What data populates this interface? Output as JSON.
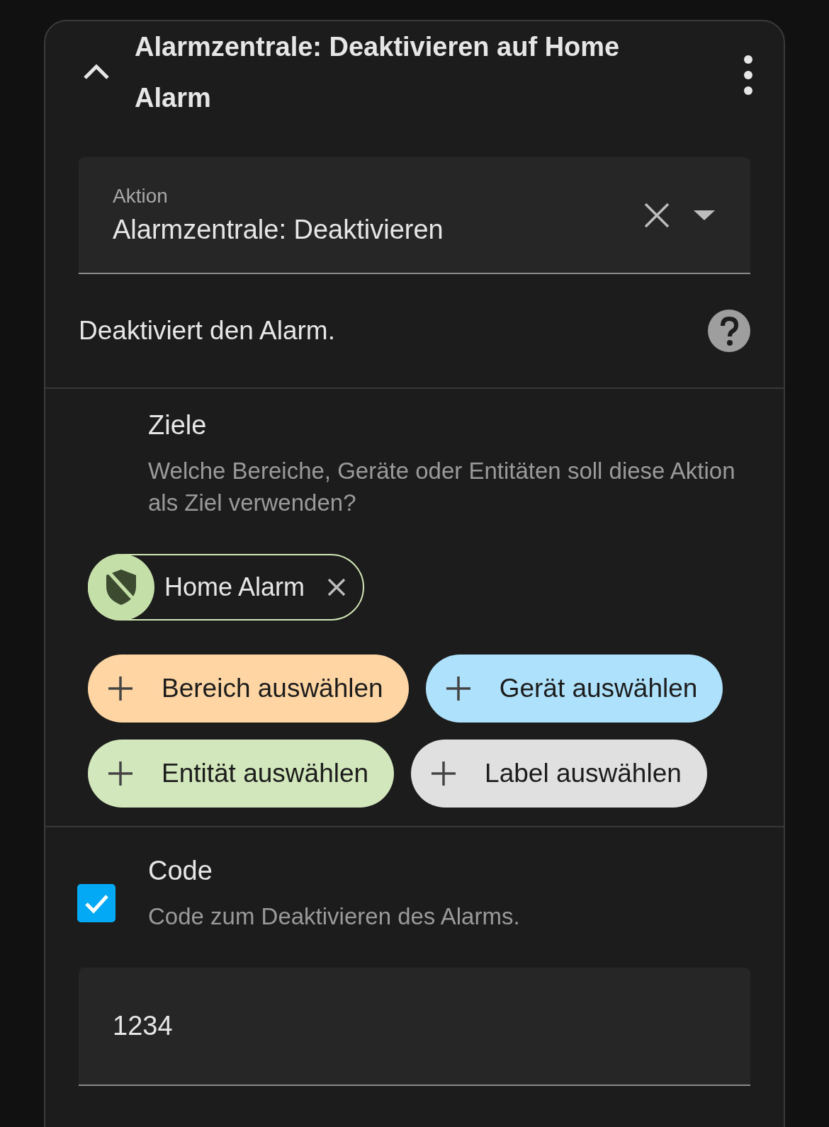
{
  "header": {
    "title": "Alarmzentrale: Deaktivieren auf Home Alarm",
    "expanded": true
  },
  "action_field": {
    "label": "Aktion",
    "value": "Alarmzentrale: Deaktivieren"
  },
  "description": "Deaktiviert den Alarm.",
  "targets": {
    "title": "Ziele",
    "subtitle": "Welche Bereiche, Geräte oder Entitäten soll diese Aktion als Ziel verwenden?",
    "chips": [
      {
        "label": "Home Alarm"
      }
    ],
    "add_buttons": [
      {
        "label": "Bereich auswählen",
        "color": "#ffd6a3"
      },
      {
        "label": "Gerät auswählen",
        "color": "#aee1fb"
      },
      {
        "label": "Entität auswählen",
        "color": "#d2e7bb"
      },
      {
        "label": "Label auswählen",
        "color": "#e0e0e0"
      }
    ]
  },
  "code": {
    "checked": true,
    "title": "Code",
    "description": "Code zum Deaktivieren des Alarms.",
    "value": "1234"
  }
}
